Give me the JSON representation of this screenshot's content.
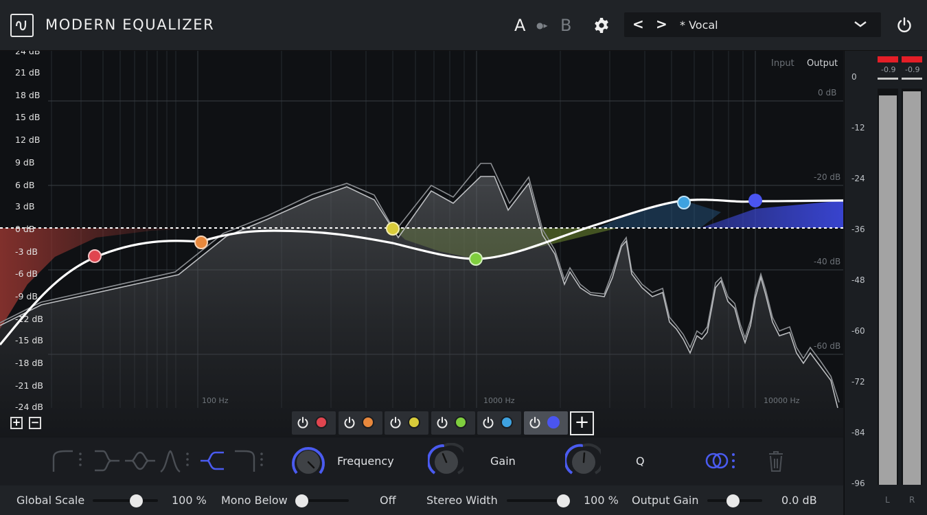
{
  "app": {
    "title": "MODERN EQUALIZER"
  },
  "ab": {
    "a": "A",
    "arrow": "●▸",
    "b": "B"
  },
  "preset": {
    "prev": "<",
    "next": ">",
    "name": "* Vocal"
  },
  "graph": {
    "db_labels": [
      "24 dB",
      "21 dB",
      "18 dB",
      "15 dB",
      "12 dB",
      "9 dB",
      "6 dB",
      "3 dB",
      "0 dB",
      "-3 dB",
      "-6 dB",
      "-9 dB",
      "-12 dB",
      "-15 dB",
      "-18 dB",
      "-21 dB",
      "-24 dB"
    ],
    "freq_labels": [
      "100 Hz",
      "1000 Hz",
      "10000 Hz"
    ],
    "input_label": "Input",
    "output_label": "Output",
    "right_db_labels": [
      "0 dB",
      "-20 dB",
      "-40 dB",
      "-60 dB"
    ],
    "band_nodes": [
      {
        "color": "#e0454f",
        "freq_hz": 40,
        "gain_db": -3.6
      },
      {
        "color": "#e8883c",
        "freq_hz": 130,
        "gain_db": -1.8
      },
      {
        "color": "#d9cc3a",
        "freq_hz": 550,
        "gain_db": 0.0
      },
      {
        "color": "#7fce3e",
        "freq_hz": 1000,
        "gain_db": -4.1
      },
      {
        "color": "#3ea2e0",
        "freq_hz": 4700,
        "gain_db": 3.5
      },
      {
        "color": "#4a55f0",
        "freq_hz": 8000,
        "gain_db": 3.7
      }
    ]
  },
  "bands": [
    {
      "color": "#e0454f",
      "active": false
    },
    {
      "color": "#e8883c",
      "active": false
    },
    {
      "color": "#d9cc3a",
      "active": false
    },
    {
      "color": "#7fce3e",
      "active": false
    },
    {
      "color": "#3ea2e0",
      "active": false
    },
    {
      "color": "#4a55f0",
      "active": true
    }
  ],
  "add_band": "+",
  "zoom": {
    "in": "+",
    "out": "−"
  },
  "controls": {
    "frequency_label": "Frequency",
    "gain_label": "Gain",
    "q_label": "Q"
  },
  "bottom": {
    "global_scale_label": "Global Scale",
    "global_scale_value": "100 %",
    "mono_below_label": "Mono Below",
    "mono_below_value": "Off",
    "stereo_width_label": "Stereo Width",
    "stereo_width_value": "100 %",
    "output_gain_label": "Output Gain",
    "output_gain_value": "0.0 dB"
  },
  "meter": {
    "scale": [
      "0",
      "-12",
      "-24",
      "-36",
      "-48",
      "-60",
      "-72",
      "-84",
      "-96"
    ],
    "peaks": [
      "-0.9",
      "-0.9"
    ],
    "channels": [
      "L",
      "R"
    ],
    "levels": [
      0.99,
      1.0
    ]
  },
  "colors": {
    "accent": "#4a5bf0",
    "clip": "#e41e27"
  }
}
